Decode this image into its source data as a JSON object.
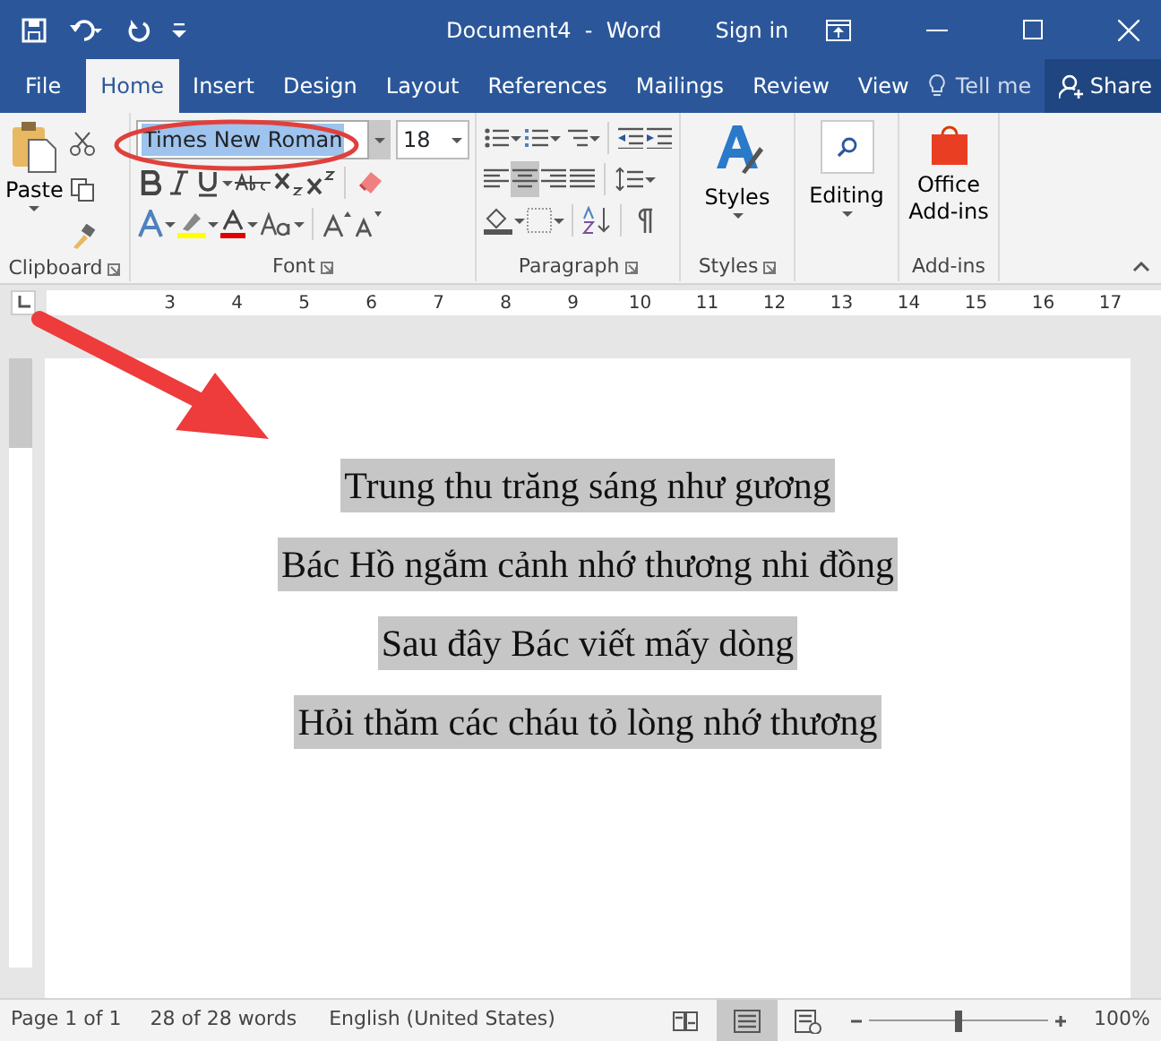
{
  "title_bar": {
    "title": "Document4  -  Word",
    "sign_in": "Sign in"
  },
  "tabs": [
    {
      "label": "File",
      "selected": false
    },
    {
      "label": "Home",
      "selected": true
    },
    {
      "label": "Insert",
      "selected": false
    },
    {
      "label": "Design",
      "selected": false
    },
    {
      "label": "Layout",
      "selected": false
    },
    {
      "label": "References",
      "selected": false
    },
    {
      "label": "Mailings",
      "selected": false
    },
    {
      "label": "Review",
      "selected": false
    },
    {
      "label": "View",
      "selected": false
    }
  ],
  "tell_me": {
    "placeholder": "Tell me"
  },
  "share": {
    "label": "Share"
  },
  "ribbon": {
    "clipboard": {
      "paste": "Paste",
      "label": "Clipboard"
    },
    "font": {
      "name": "Times New Roman",
      "name_selected": true,
      "size": "18",
      "label": "Font"
    },
    "paragraph": {
      "label": "Paragraph",
      "align": [
        {
          "kind": "left",
          "selected": false
        },
        {
          "kind": "center",
          "selected": true
        },
        {
          "kind": "right",
          "selected": false
        },
        {
          "kind": "justify",
          "selected": false
        }
      ]
    },
    "styles": {
      "button": "Styles",
      "label": "Styles"
    },
    "editing": {
      "button": "Editing"
    },
    "add_ins": {
      "button": "Office Add-ins",
      "label": "Add-ins"
    }
  },
  "ruler": {
    "numbers": [
      "3",
      "4",
      "5",
      "6",
      "7",
      "8",
      "9",
      "10",
      "11",
      "12",
      "13",
      "14",
      "15",
      "16",
      "17"
    ]
  },
  "document": {
    "selected": true,
    "lines": [
      "Trung thu trăng sáng như gương",
      "Bác Hồ ngắm cảnh nhớ thương nhi đồng",
      "Sau đây Bác viết mấy dòng",
      "Hỏi thăm các cháu tỏ lòng nhớ thương"
    ]
  },
  "status_bar": {
    "page": "Page 1 of 1",
    "words": "28 of 28 words",
    "language": "English (United States)",
    "views": [
      {
        "kind": "read",
        "selected": false
      },
      {
        "kind": "print",
        "selected": true
      },
      {
        "kind": "web",
        "selected": false
      }
    ],
    "zoom": {
      "level": 0.5,
      "reading": "100%"
    }
  }
}
